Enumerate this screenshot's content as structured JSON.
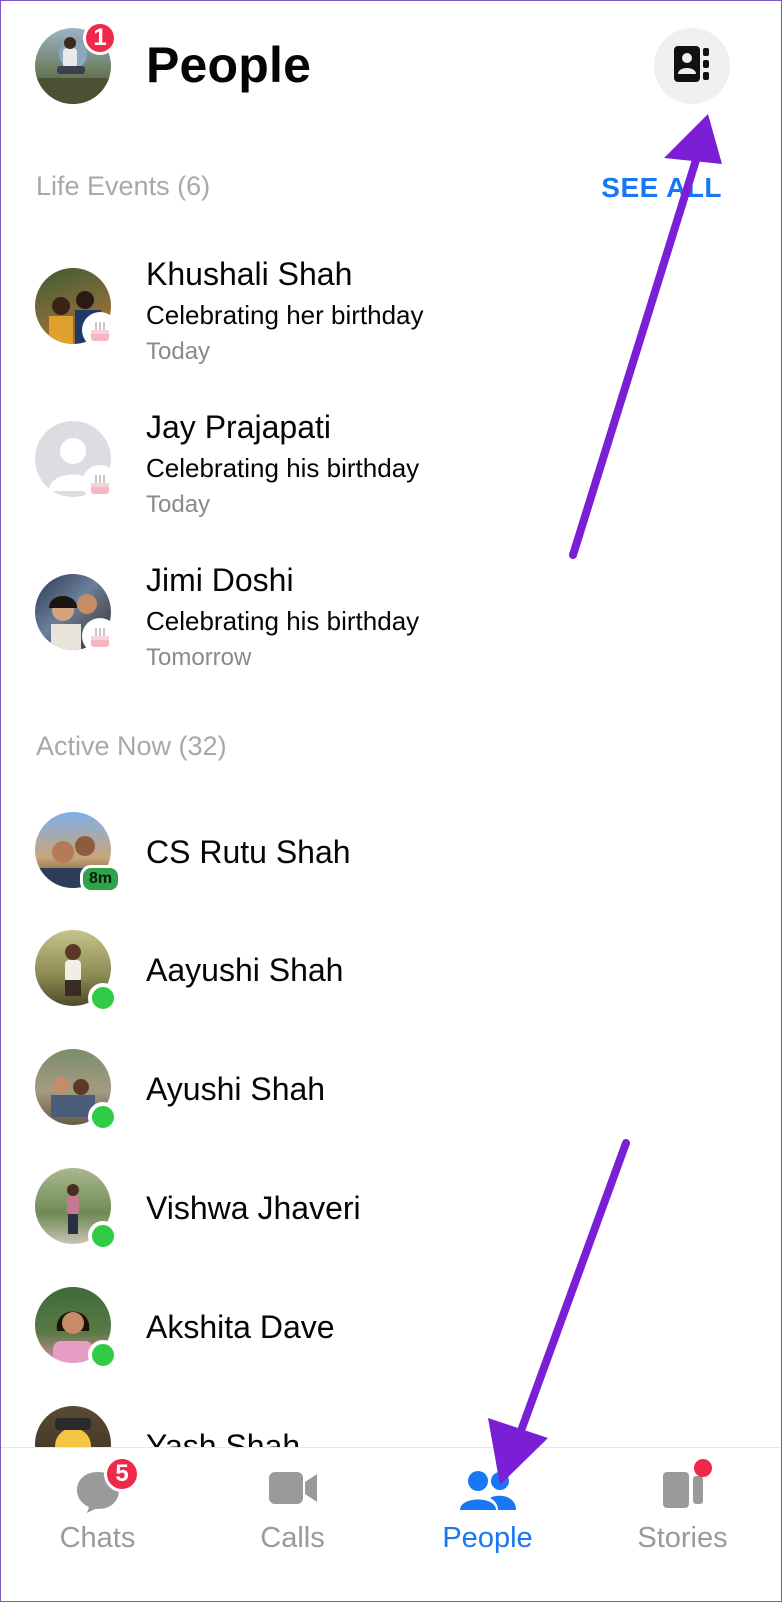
{
  "header": {
    "title": "People",
    "profile_badge_count": "1"
  },
  "life_events": {
    "section_title": "Life Events (6)",
    "see_all_label": "SEE ALL",
    "items": [
      {
        "name": "Khushali Shah",
        "event": "Celebrating her birthday",
        "when": "Today"
      },
      {
        "name": "Jay Prajapati",
        "event": "Celebrating his birthday",
        "when": "Today"
      },
      {
        "name": "Jimi Doshi",
        "event": "Celebrating his birthday",
        "when": "Tomorrow"
      }
    ]
  },
  "active_now": {
    "section_title": "Active Now (32)",
    "items": [
      {
        "name": "CS Rutu Shah",
        "status": "8m"
      },
      {
        "name": "Aayushi Shah"
      },
      {
        "name": "Ayushi Shah"
      },
      {
        "name": "Vishwa Jhaveri"
      },
      {
        "name": "Akshita Dave"
      },
      {
        "name": "Yash Shah"
      }
    ]
  },
  "bottom_nav": {
    "items": [
      {
        "label": "Chats",
        "icon": "chat-bubble-icon",
        "badge": "5"
      },
      {
        "label": "Calls",
        "icon": "video-camera-icon"
      },
      {
        "label": "People",
        "icon": "people-icon",
        "active": true
      },
      {
        "label": "Stories",
        "icon": "stories-icon",
        "dot": true
      }
    ]
  },
  "colors": {
    "accent": "#1877f2",
    "badge": "#f02849",
    "online": "#31cc46",
    "annotation_arrow": "#7b1fd6",
    "muted_text": "#a8a8a8"
  }
}
